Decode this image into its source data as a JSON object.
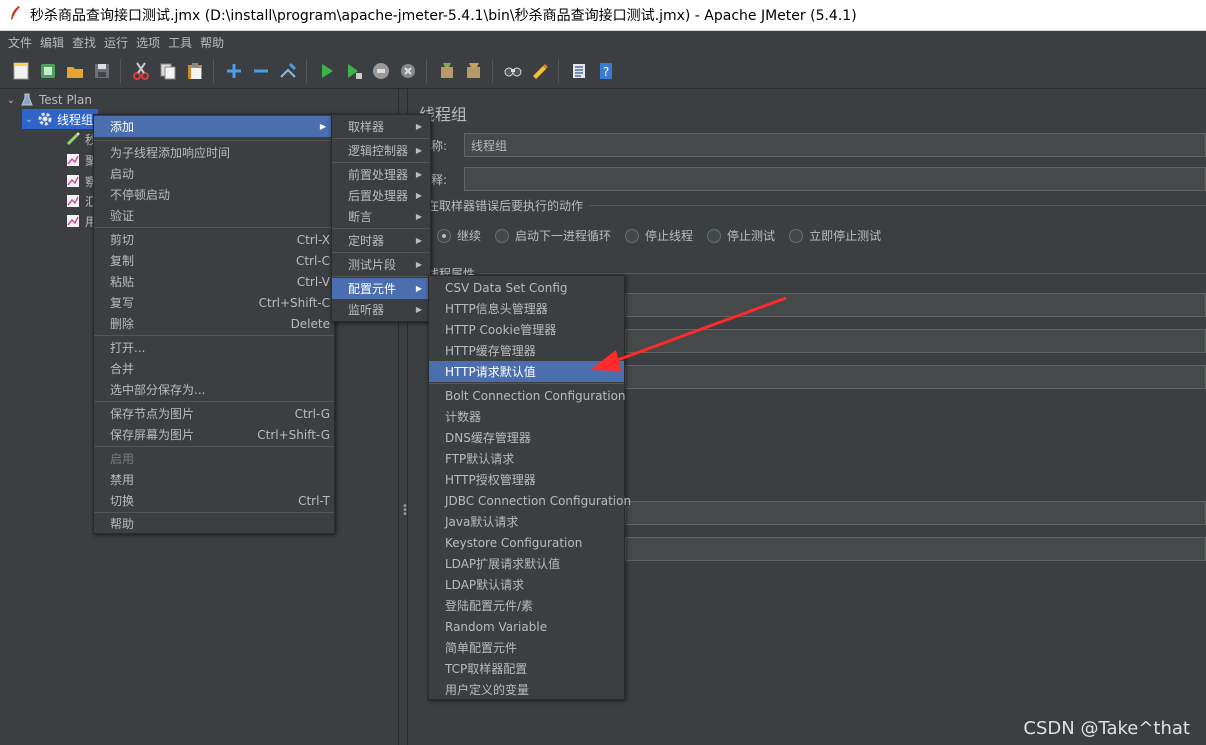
{
  "window": {
    "title": "秒杀商品查询接口测试.jmx (D:\\install\\program\\apache-jmeter-5.4.1\\bin\\秒杀商品查询接口测试.jmx) - Apache JMeter (5.4.1)"
  },
  "menubar": [
    "文件",
    "编辑",
    "查找",
    "运行",
    "选项",
    "工具",
    "帮助"
  ],
  "toolbar": {
    "icons": [
      "new-icon",
      "templates-icon",
      "open-icon",
      "save-icon",
      "cut-icon",
      "copy-icon",
      "paste-icon",
      "expand-icon",
      "collapse-icon",
      "toggle-icon",
      "start-icon",
      "start-no-pause-icon",
      "stop-icon",
      "shutdown-icon",
      "clear-icon",
      "clear-all-icon",
      "search-icon",
      "reset-search-icon",
      "function-helper-icon",
      "help-icon"
    ]
  },
  "tree": {
    "items": [
      {
        "label": "Test Plan",
        "icon": "test-plan-icon"
      },
      {
        "label": "线程组",
        "icon": "gear-icon"
      },
      {
        "label": "秒",
        "icon": "sampler-icon"
      },
      {
        "label": "聚",
        "icon": "listener-icon"
      },
      {
        "label": "察",
        "icon": "listener-icon"
      },
      {
        "label": "汇",
        "icon": "listener-icon"
      },
      {
        "label": "用",
        "icon": "listener-icon"
      }
    ]
  },
  "panel": {
    "title": "线程组",
    "name_label": "称:",
    "name_value": "线程组",
    "comment_label": "释:",
    "error_action_label": "在取样器错误后要执行的动作",
    "error_options": [
      "继续",
      "启动下一进程循环",
      "停止线程",
      "停止测试",
      "立即停止测试"
    ],
    "error_selected": 0,
    "thread_props_label": "线程属性"
  },
  "context_menu": {
    "items": [
      {
        "label": "添加",
        "submenu": true,
        "highlight": true
      },
      {
        "sep": true
      },
      {
        "label": "为子线程添加响应时间"
      },
      {
        "label": "启动"
      },
      {
        "label": "不停顿启动"
      },
      {
        "label": "验证"
      },
      {
        "sep": true
      },
      {
        "label": "剪切",
        "shortcut": "Ctrl-X"
      },
      {
        "label": "复制",
        "shortcut": "Ctrl-C"
      },
      {
        "label": "粘贴",
        "shortcut": "Ctrl-V"
      },
      {
        "label": "复写",
        "shortcut": "Ctrl+Shift-C"
      },
      {
        "label": "删除",
        "shortcut": "Delete"
      },
      {
        "sep": true
      },
      {
        "label": "打开..."
      },
      {
        "label": "合并"
      },
      {
        "label": "选中部分保存为..."
      },
      {
        "sep": true
      },
      {
        "label": "保存节点为图片",
        "shortcut": "Ctrl-G"
      },
      {
        "label": "保存屏幕为图片",
        "shortcut": "Ctrl+Shift-G"
      },
      {
        "sep": true
      },
      {
        "label": "启用",
        "disabled": true
      },
      {
        "label": "禁用"
      },
      {
        "label": "切换",
        "shortcut": "Ctrl-T"
      },
      {
        "sep": true
      },
      {
        "label": "帮助"
      }
    ]
  },
  "add_submenu": {
    "items": [
      {
        "label": "取样器"
      },
      {
        "sep": true
      },
      {
        "label": "逻辑控制器"
      },
      {
        "sep": true
      },
      {
        "label": "前置处理器"
      },
      {
        "label": "后置处理器"
      },
      {
        "label": "断言"
      },
      {
        "sep": true
      },
      {
        "label": "定时器"
      },
      {
        "sep": true
      },
      {
        "label": "测试片段"
      },
      {
        "sep": true
      },
      {
        "label": "配置元件",
        "highlight": true
      },
      {
        "label": "监听器"
      }
    ]
  },
  "config_submenu": {
    "items": [
      {
        "label": "CSV Data Set Config"
      },
      {
        "label": "HTTP信息头管理器"
      },
      {
        "label": "HTTP Cookie管理器"
      },
      {
        "label": "HTTP缓存管理器"
      },
      {
        "label": "HTTP请求默认值",
        "highlight": true
      },
      {
        "sep": true
      },
      {
        "label": "Bolt Connection Configuration"
      },
      {
        "label": "计数器"
      },
      {
        "label": "DNS缓存管理器"
      },
      {
        "label": "FTP默认请求"
      },
      {
        "label": "HTTP授权管理器"
      },
      {
        "label": "JDBC Connection Configuration"
      },
      {
        "label": "Java默认请求"
      },
      {
        "label": "Keystore Configuration"
      },
      {
        "label": "LDAP扩展请求默认值"
      },
      {
        "label": "LDAP默认请求"
      },
      {
        "label": "登陆配置元件/素"
      },
      {
        "label": "Random Variable"
      },
      {
        "label": "简单配置元件"
      },
      {
        "label": "TCP取样器配置"
      },
      {
        "label": "用户定义的变量"
      }
    ]
  },
  "annotation": {
    "color": "#ff2a2a"
  },
  "watermark": "CSDN @Take^that"
}
